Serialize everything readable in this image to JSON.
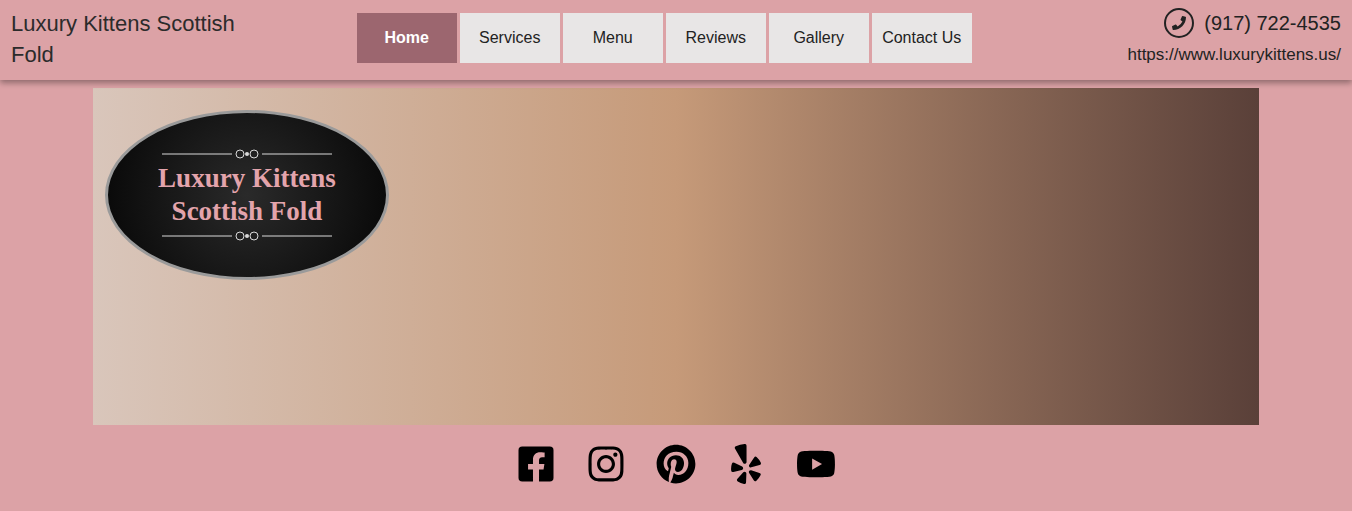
{
  "header": {
    "title": "Luxury Kittens Scottish Fold",
    "phone": "(917) 722-4535",
    "url": "https://www.luxurykittens.us/"
  },
  "nav": [
    {
      "label": "Home",
      "selected": true
    },
    {
      "label": "Services",
      "selected": false
    },
    {
      "label": "Menu",
      "selected": false
    },
    {
      "label": "Reviews",
      "selected": false
    },
    {
      "label": "Gallery",
      "selected": false
    },
    {
      "label": "Contact Us",
      "selected": false
    }
  ],
  "hero": {
    "logo": {
      "line1": "Luxury Kittens",
      "line2": "Scottish Fold"
    }
  },
  "social": [
    {
      "kind": "facebook"
    },
    {
      "kind": "instagram"
    },
    {
      "kind": "pinterest"
    },
    {
      "kind": "yelp"
    },
    {
      "kind": "youtube"
    }
  ]
}
